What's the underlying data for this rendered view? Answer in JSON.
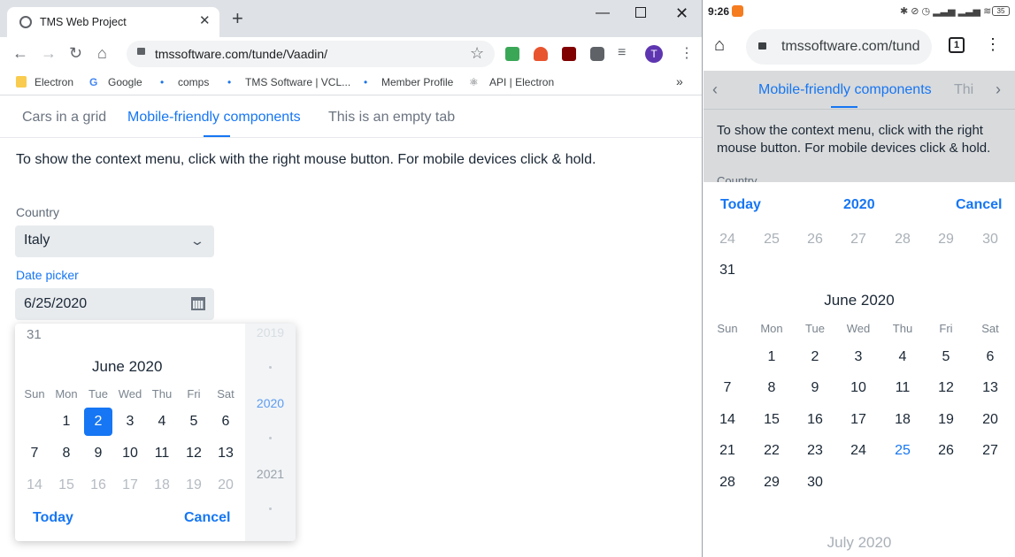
{
  "desktop": {
    "tab_title": "TMS Web Project",
    "url": "tmssoftware.com/tunde/Vaadin/",
    "bookmarks": [
      "Electron",
      "Google",
      "comps",
      "TMS Software | VCL...",
      "Member Profile",
      "API | Electron"
    ],
    "profile_initial": "T",
    "page_tabs": [
      "Cars in a grid",
      "Mobile-friendly components",
      "This is an empty tab"
    ],
    "instruction": "To show the context menu, click with the right mouse button. For mobile devices click & hold.",
    "country_label": "Country",
    "country_value": "Italy",
    "date_label": "Date picker",
    "date_value": "6/25/2020",
    "calendar": {
      "prev_tail_day": "31",
      "month_title": "June 2020",
      "weekdays": [
        "Sun",
        "Mon",
        "Tue",
        "Wed",
        "Thu",
        "Fri",
        "Sat"
      ],
      "week1": [
        "1",
        "2",
        "3",
        "4",
        "5",
        "6"
      ],
      "week2": [
        "7",
        "8",
        "9",
        "10",
        "11",
        "12",
        "13"
      ],
      "week3": [
        "14",
        "15",
        "16",
        "17",
        "18",
        "19",
        "20"
      ],
      "selected_day": "2",
      "years": [
        "2019",
        "2020",
        "2021"
      ],
      "selected_year": "2020",
      "today": "Today",
      "cancel": "Cancel"
    },
    "colors": {
      "accent": "#1676f3"
    }
  },
  "mobile": {
    "time": "9:26",
    "battery": "35",
    "url": "tmssoftware.com/tund",
    "tab_count": "1",
    "tabs": [
      "Mobile-friendly components",
      "Thi"
    ],
    "instruction": "To show the context menu, click with the right mouse button. For mobile devices click & hold.",
    "country_label": "Country",
    "today": "Today",
    "year": "2020",
    "cancel": "Cancel",
    "prev_row": [
      "24",
      "25",
      "26",
      "27",
      "28",
      "29",
      "30"
    ],
    "prev_last": "31",
    "month_title": "June 2020",
    "weekdays": [
      "Sun",
      "Mon",
      "Tue",
      "Wed",
      "Thu",
      "Fri",
      "Sat"
    ],
    "weeks": [
      [
        "",
        "1",
        "2",
        "3",
        "4",
        "5",
        "6"
      ],
      [
        "7",
        "8",
        "9",
        "10",
        "11",
        "12",
        "13"
      ],
      [
        "14",
        "15",
        "16",
        "17",
        "18",
        "19",
        "20"
      ],
      [
        "21",
        "22",
        "23",
        "24",
        "25",
        "26",
        "27"
      ],
      [
        "28",
        "29",
        "30"
      ]
    ],
    "highlighted_day": "25",
    "next_month_title": "July 2020"
  }
}
